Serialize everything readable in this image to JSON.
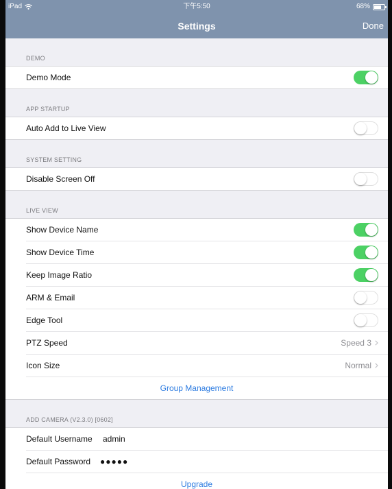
{
  "status_bar": {
    "device": "iPad",
    "time": "下午5:50",
    "battery": "68%",
    "battery_level": 0.68
  },
  "nav": {
    "title": "Settings",
    "done_label": "Done"
  },
  "sections": {
    "demo": {
      "header": "DEMO",
      "demo_mode": {
        "label": "Demo Mode",
        "on": true
      }
    },
    "app_startup": {
      "header": "APP STARTUP",
      "auto_add": {
        "label": "Auto Add to Live View",
        "on": false
      }
    },
    "system_setting": {
      "header": "SYSTEM SETTING",
      "disable_screen_off": {
        "label": "Disable Screen Off",
        "on": false
      }
    },
    "live_view": {
      "header": "LIVE VIEW",
      "show_device_name": {
        "label": "Show Device Name",
        "on": true
      },
      "show_device_time": {
        "label": "Show Device Time",
        "on": true
      },
      "keep_image_ratio": {
        "label": "Keep Image Ratio",
        "on": true
      },
      "arm_email": {
        "label": "ARM & Email",
        "on": false
      },
      "edge_tool": {
        "label": "Edge Tool",
        "on": false
      },
      "ptz_speed": {
        "label": "PTZ Speed",
        "value": "Speed 3"
      },
      "icon_size": {
        "label": "Icon Size",
        "value": "Normal"
      },
      "group_management": "Group Management"
    },
    "add_camera": {
      "header": "ADD CAMERA (V2.3.0) [0602]",
      "username_label": "Default Username",
      "username_value": "admin",
      "password_label": "Default Password",
      "password_dots": "●●●●●",
      "upgrade": "Upgrade"
    }
  },
  "colors": {
    "header_bg": "#7f93ad",
    "toggle_on": "#4cd164",
    "link": "#2f7de1"
  }
}
